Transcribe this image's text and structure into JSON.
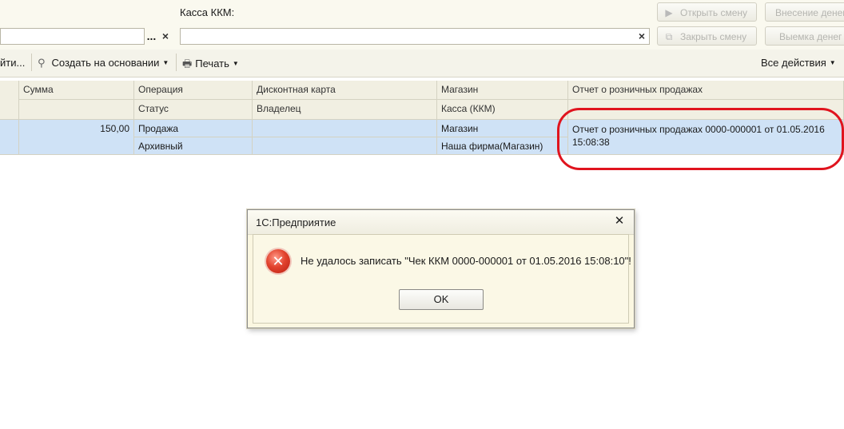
{
  "form": {
    "kassa_label": "Касса ККМ:",
    "left_field_value": "",
    "kassa_field_value": "",
    "dots_label": "...",
    "clear_glyph": "×"
  },
  "side_buttons": {
    "open_shift": "Открыть смену",
    "close_shift": "Закрыть смену",
    "deposit": "Внесение денег",
    "withdraw": "Выемка денег"
  },
  "toolbar": {
    "find_partial": "йти...",
    "create_based": "Создать на основании",
    "print": "Печать",
    "all_actions": "Все действия"
  },
  "table": {
    "headers_row1": [
      "Сумма",
      "Операция",
      "Дисконтная карта",
      "Магазин",
      "Отчет о розничных продажах"
    ],
    "headers_row2": [
      "",
      "Статус",
      "Владелец",
      "Касса (ККМ)",
      ""
    ],
    "rows": [
      {
        "sum": "150,00",
        "operation": "Продажа",
        "status": "Архивный",
        "discount_card": "",
        "owner": "",
        "shop": "Магазин",
        "register": "Наша фирма(Магазин)",
        "report_line1": "Отчет о розничных продажах 0000-000001 от 01.05.2016",
        "report_line2": "15:08:38"
      }
    ]
  },
  "dialog": {
    "title": "1С:Предприятие",
    "message": "Не удалось записать \"Чек ККМ 0000-000001 от 01.05.2016 15:08:10\"!",
    "ok_label": "OK",
    "close_glyph": "✕",
    "error_glyph": "✕"
  },
  "colors": {
    "highlight": "#e0141e",
    "selected_row": "#cfe2f6",
    "header_bg": "#f1efe2"
  }
}
